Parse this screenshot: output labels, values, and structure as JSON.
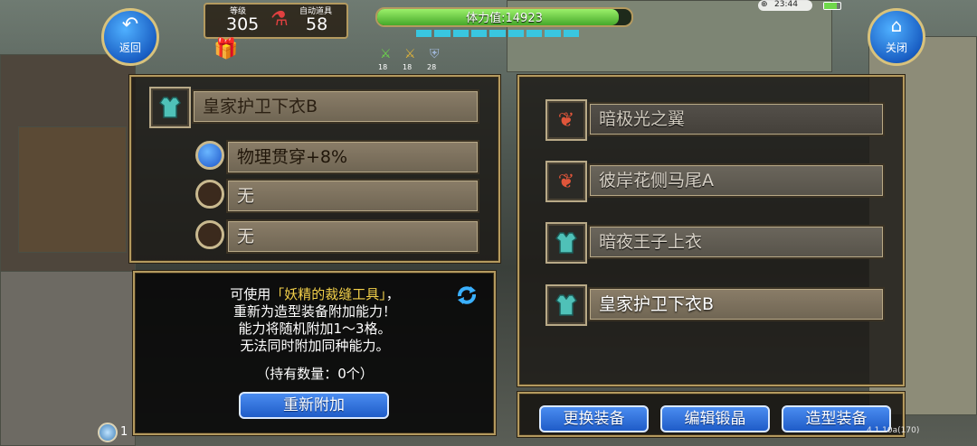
{
  "top": {
    "back_label": "返回",
    "close_label": "关闭",
    "level_label": "等级",
    "level_value": "305",
    "potion_label": "自动道具",
    "potion_value": "58",
    "stamina_text": "体力值:14923",
    "stamina_fraction": 0.95,
    "clock": "23:44",
    "buffs": [
      "18",
      "18",
      "28"
    ]
  },
  "left_panel": {
    "item_name": "皇家护卫下衣B",
    "abilities": [
      {
        "text": "物理贯穿+8%",
        "filled": true
      },
      {
        "text": "无",
        "filled": false
      },
      {
        "text": "无",
        "filled": false
      }
    ],
    "info": {
      "line1_prefix": "可使用",
      "line1_tool": "「妖精的裁缝工具」",
      "line1_suffix": "，",
      "line2": "重新为造型装备附加能力！",
      "line3": "能力将随机附加1～3格。",
      "line4": "无法同时附加同种能力。",
      "count_text": "（持有数量：0个）",
      "reattach_button": "重新附加"
    }
  },
  "right_panel": {
    "items": [
      {
        "name": "暗极光之翼",
        "icon": "wing-icon",
        "active": false
      },
      {
        "name": "彼岸花侧马尾A",
        "icon": "bow-icon",
        "active": false
      },
      {
        "name": "暗夜王子上衣",
        "icon": "armor-icon",
        "active": false
      },
      {
        "name": "皇家护卫下衣B",
        "icon": "armor-icon",
        "active": true
      }
    ]
  },
  "bottom": {
    "buttons": [
      "更换装备",
      "编辑锻晶",
      "造型装备"
    ],
    "version": "4.1.10a(170)",
    "bottom_left_text": "1"
  },
  "colors": {
    "accent_gold": "#b49a5f",
    "button_blue": "#1f5cc8",
    "tool_yellow": "#f2d04a",
    "stamina_green": "#6fd84a"
  }
}
